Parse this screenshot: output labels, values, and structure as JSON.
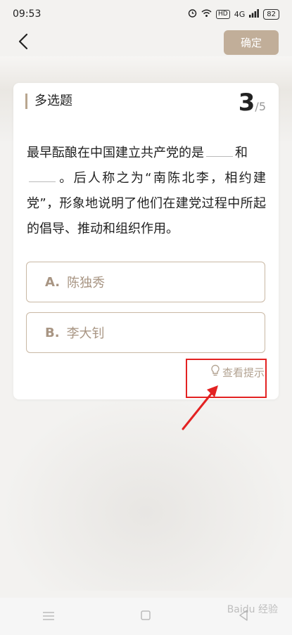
{
  "status_bar": {
    "time": "09:53",
    "badge_hd": "HD",
    "network": "4G",
    "battery": "82"
  },
  "header": {
    "confirm_label": "确定"
  },
  "question": {
    "type_label": "多选题",
    "current": "3",
    "total": "/5",
    "text_part1": "最早酝酿在中国建立共产党的是",
    "text_part2": "和",
    "text_part3": "。后人称之为“南陈北李，相约建党”，形象地说明了他们在建党过程中所起的倡导、推动和组织作用。"
  },
  "options": [
    {
      "key": "A.",
      "label": "陈独秀"
    },
    {
      "key": "B.",
      "label": "李大钊"
    }
  ],
  "hint": {
    "label": "查看提示"
  },
  "watermark": "Baidu 经验",
  "colors": {
    "accent": "#c1ae99",
    "option_border": "#c9b8a4",
    "option_text": "#a89583",
    "annotation_red": "#e32222"
  }
}
